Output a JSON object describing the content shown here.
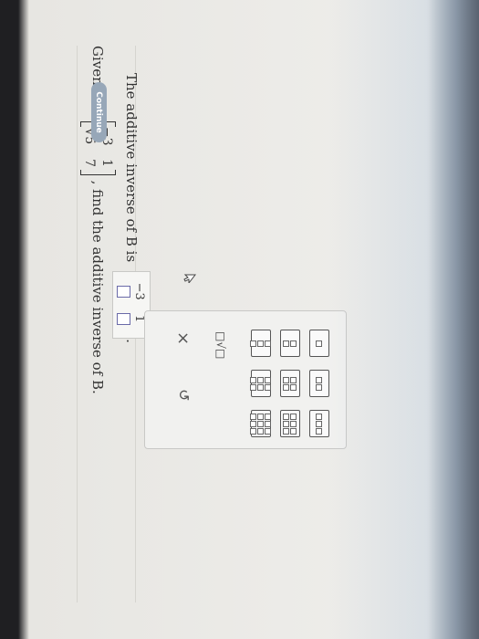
{
  "problem": {
    "prefix": "Given B =",
    "matrix": [
      [
        "−3",
        "1"
      ],
      [
        "√5",
        "7"
      ]
    ],
    "suffix": ", find the additive inverse of B."
  },
  "answer": {
    "prefix": "The additive inverse of B is",
    "matrix_top": [
      "−3",
      "1"
    ],
    "suffix": "."
  },
  "palette": {
    "sqrt_label": "□√□",
    "clear_label": "×",
    "undo_label": "↺"
  },
  "continue_label": "Continue"
}
